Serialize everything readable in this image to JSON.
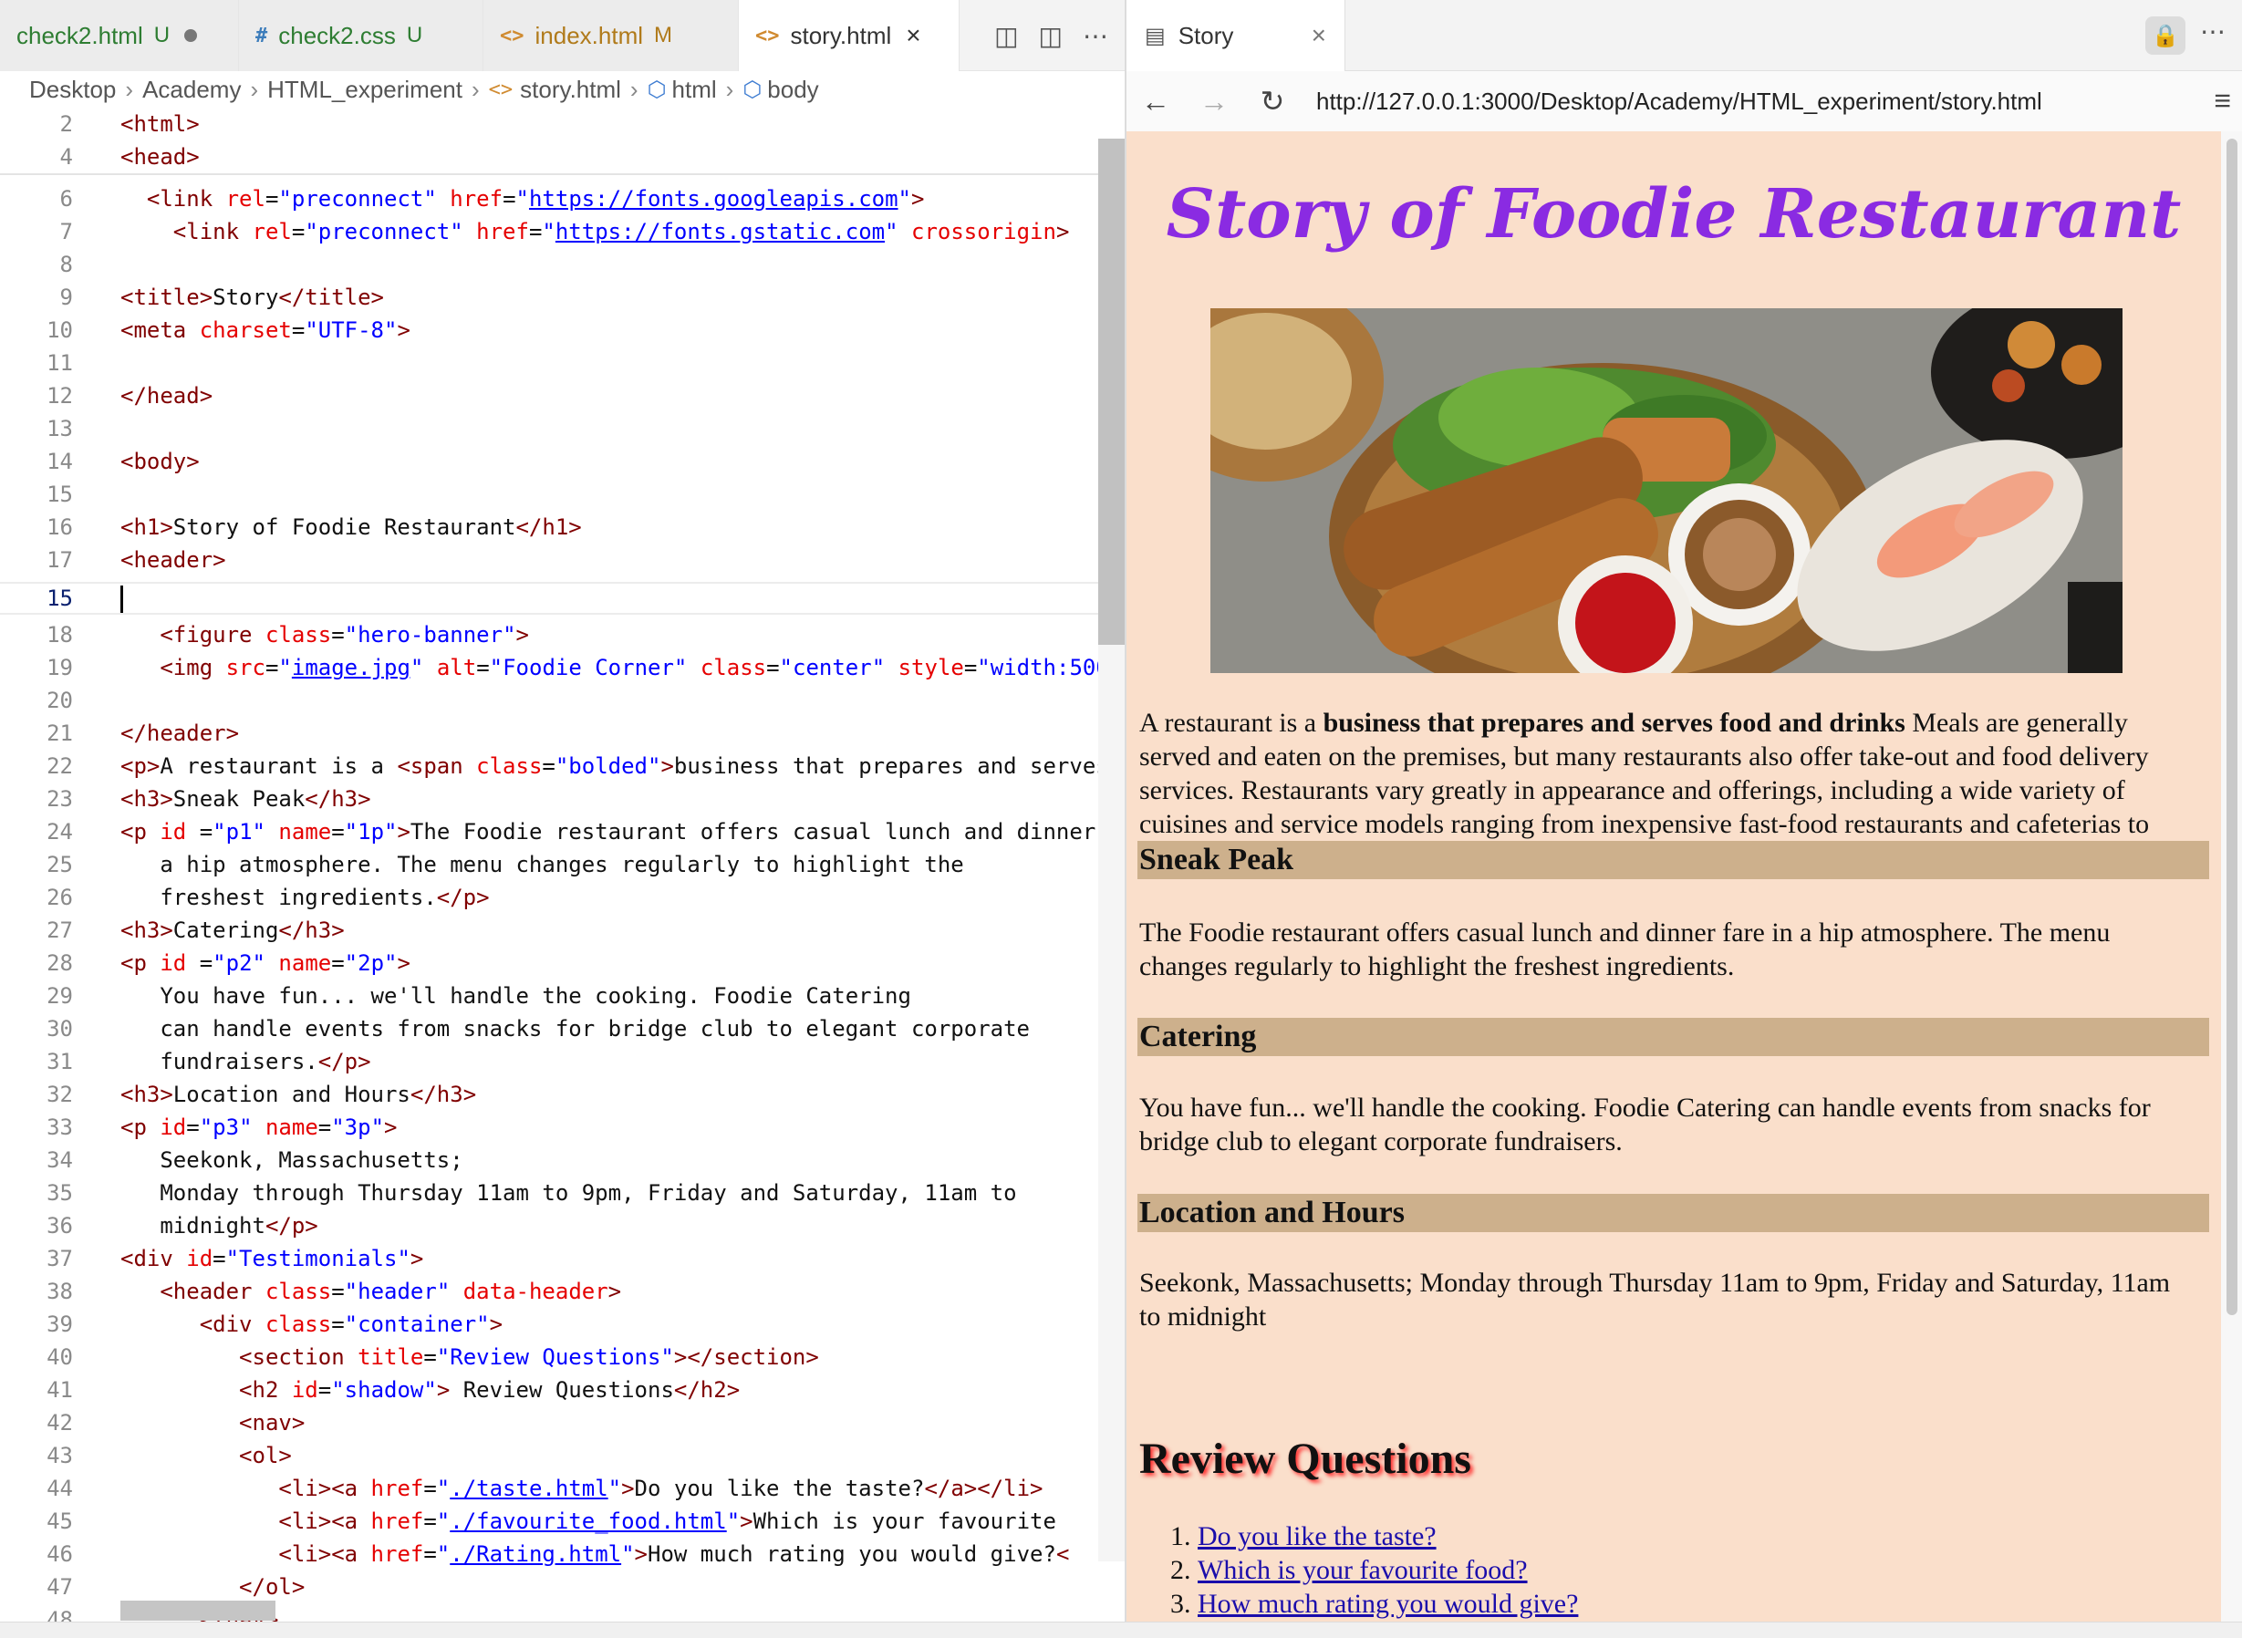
{
  "editor": {
    "tabs": [
      {
        "name": "check2.html",
        "status": "U",
        "dirty": true,
        "color": "#2e7d32"
      },
      {
        "name": "check2.css",
        "status": "U",
        "icon": "#",
        "color": "#2e7d32"
      },
      {
        "name": "index.html",
        "status": "M",
        "icon": "<>",
        "color": "#b07a1a"
      },
      {
        "name": "story.html",
        "close": "×",
        "icon": "<>",
        "color": "#333333"
      }
    ],
    "breadcrumb": [
      "Desktop",
      "Academy",
      "HTML_experiment",
      "story.html",
      "html",
      "body"
    ],
    "current_line": "15"
  },
  "browser": {
    "tab_title": "Story",
    "tab_close": "×",
    "url": "http://127.0.0.1:3000/Desktop/Academy/HTML_experiment/story.html",
    "page": {
      "title": "Story of Foodie Restaurant",
      "intro_prefix": "A restaurant is a ",
      "intro_bold": "business that prepares and serves food and drinks",
      "intro_rest": " Meals are generally served and eaten on the premises, but many restaurants also offer take-out and food delivery services. Restaurants vary greatly in appearance and offerings, including a wide variety of cuisines and service models ranging from inexpensive fast-food restaurants and cafeterias to mid-priced family restaurants, to high-priced luxury establishments.",
      "sneak_heading": "Sneak Peak",
      "sneak_text": "The Foodie restaurant offers casual lunch and dinner fare in a hip atmosphere. The menu changes regularly to highlight the freshest ingredients.",
      "catering_heading": "Catering",
      "catering_text": "You have fun... we'll handle the cooking. Foodie Catering can handle events from snacks for bridge club to elegant corporate fundraisers.",
      "location_heading": "Location and Hours",
      "location_text": "Seekonk, Massachusetts; Monday through Thursday 11am to 9pm, Friday and Saturday, 11am to midnight",
      "review_heading": "Review Questions",
      "review_items": [
        "Do you like the taste?",
        "Which is your favourite food?",
        "How much rating you would give?"
      ]
    }
  },
  "colors": {
    "title": "#8a2be2",
    "page_bg": "#fadfcb",
    "heading_bar": "#cdb08c",
    "tag": "#800000",
    "attr": "#e50000",
    "value": "#0000ff"
  }
}
